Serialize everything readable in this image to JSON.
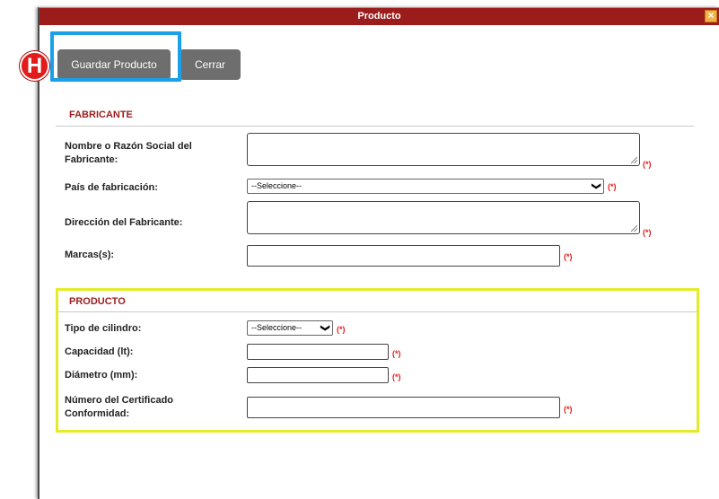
{
  "window": {
    "title": "Producto",
    "close_symbol": "×"
  },
  "toolbar": {
    "save_label": "Guardar Producto",
    "close_label": "Cerrar"
  },
  "marker": {
    "letter": "H"
  },
  "required_mark": "(*)",
  "fabricante": {
    "title": "FABRICANTE",
    "nombre_label_1": "Nombre o Razón Social del",
    "nombre_label_2": "Fabricante:",
    "pais_label": "País de fabricación:",
    "pais_selected": "--Seleccione--",
    "direccion_label": "Dirección del Fabricante:",
    "marcas_label": "Marcas(s):"
  },
  "producto": {
    "title": "PRODUCTO",
    "tipo_label": "Tipo de cilindro:",
    "tipo_selected": "--Seleccione--",
    "capacidad_label": "Capacidad (lt):",
    "diametro_label": "Diámetro (mm):",
    "certificado_label_1": "Número del Certificado",
    "certificado_label_2": "Conformidad:"
  },
  "colors": {
    "titlebar": "#9c1c1c",
    "button": "#6e6e6e",
    "highlight_blue": "#1aa0e6",
    "highlight_yellow": "#e4ec2a",
    "required": "#e21b1b",
    "section_title": "#9c1c1c"
  }
}
